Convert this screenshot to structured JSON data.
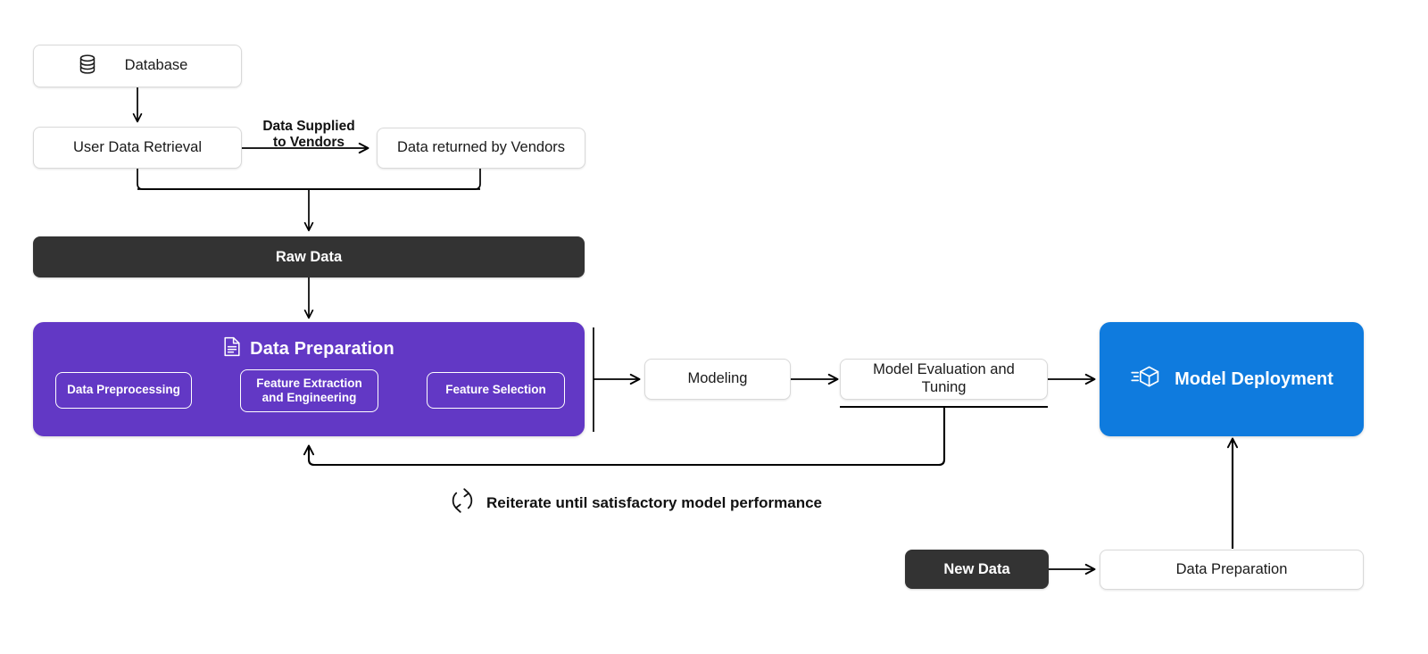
{
  "diagram": {
    "title": "Machine Learning Pipeline",
    "colors": {
      "purple": "#6238C5",
      "blue": "#0F7BDE",
      "dark": "#333333",
      "card_border": "#d9d9d9",
      "line": "#000000",
      "background": "#ffffff"
    }
  },
  "nodes": {
    "database": {
      "label": "Database",
      "icon": "database-icon",
      "style": "card"
    },
    "user_data_retrieval": {
      "label": "User Data Retrieval",
      "style": "card"
    },
    "data_returned_by_vendors": {
      "label": "Data returned by Vendors",
      "style": "card"
    },
    "raw_data": {
      "label": "Raw Data",
      "style": "dark"
    },
    "data_preparation": {
      "label": "Data Preparation",
      "icon": "document-icon",
      "style": "panel-purple",
      "steps": [
        {
          "label": "Data Preprocessing"
        },
        {
          "label": "Feature Extraction\nand Engineering"
        },
        {
          "label": "Feature Selection"
        }
      ]
    },
    "modeling": {
      "label": "Modeling",
      "style": "card"
    },
    "model_evaluation_and_tuning": {
      "label": "Model Evaluation and Tuning",
      "style": "card"
    },
    "model_deployment": {
      "label": "Model Deployment",
      "icon": "deploy-cube-icon",
      "style": "panel-blue"
    },
    "new_data": {
      "label": "New Data",
      "style": "dark"
    },
    "data_preparation_inference": {
      "label": "Data Preparation",
      "style": "card"
    }
  },
  "edges": {
    "data_supplied_to_vendors": {
      "label": "Data Supplied\nto Vendors"
    },
    "reiterate": {
      "label": "Reiterate until satisfactory model performance",
      "icon": "refresh-cycle-icon"
    }
  }
}
